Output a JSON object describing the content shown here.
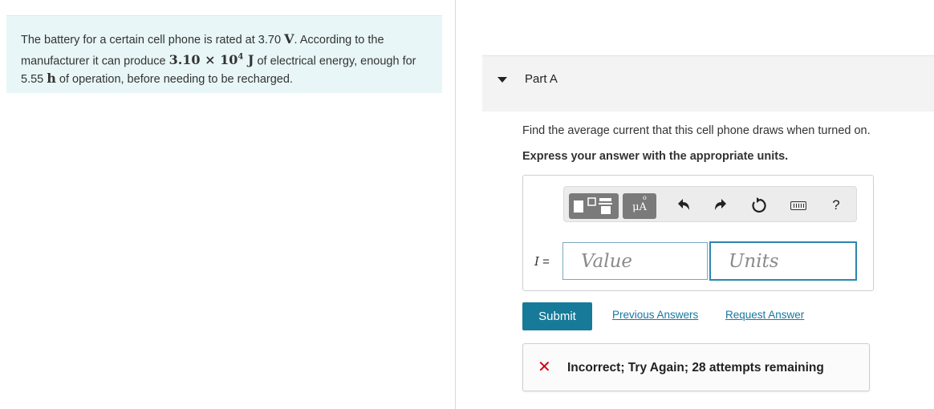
{
  "problem": {
    "t1": "The battery for a certain cell phone is rated at 3.70 ",
    "m1": "V",
    "t2": ". According to the manufacturer it can produce ",
    "m2_base": "3.10 × 10",
    "m2_exp": "4",
    "m2_unit": " J",
    "t3": " of electrical energy, enough for 5.55 ",
    "m3": "h",
    "t4": " of operation, before needing to be recharged."
  },
  "part": {
    "title": "Part A"
  },
  "question": "Find the average current that this cell phone draws when turned on.",
  "instruction": "Express your answer with the appropriate units.",
  "toolbar": {
    "units_label": "μA",
    "units_ring": "o",
    "help_label": "?",
    "icons": [
      "templates-icon",
      "units-icon",
      "undo-icon",
      "redo-icon",
      "reset-icon",
      "keyboard-icon",
      "help-icon"
    ]
  },
  "answer": {
    "variable": "I",
    "equals": " =",
    "value_placeholder": "Value",
    "units_placeholder": "Units"
  },
  "actions": {
    "submit": "Submit",
    "previous": "Previous Answers",
    "request": "Request Answer"
  },
  "feedback": {
    "message": "Incorrect; Try Again; 28 attempts remaining",
    "status_color": "#d0021b"
  },
  "colors": {
    "accent": "#187a99",
    "link": "#1677a3",
    "problem_bg": "#e8f6f7"
  }
}
